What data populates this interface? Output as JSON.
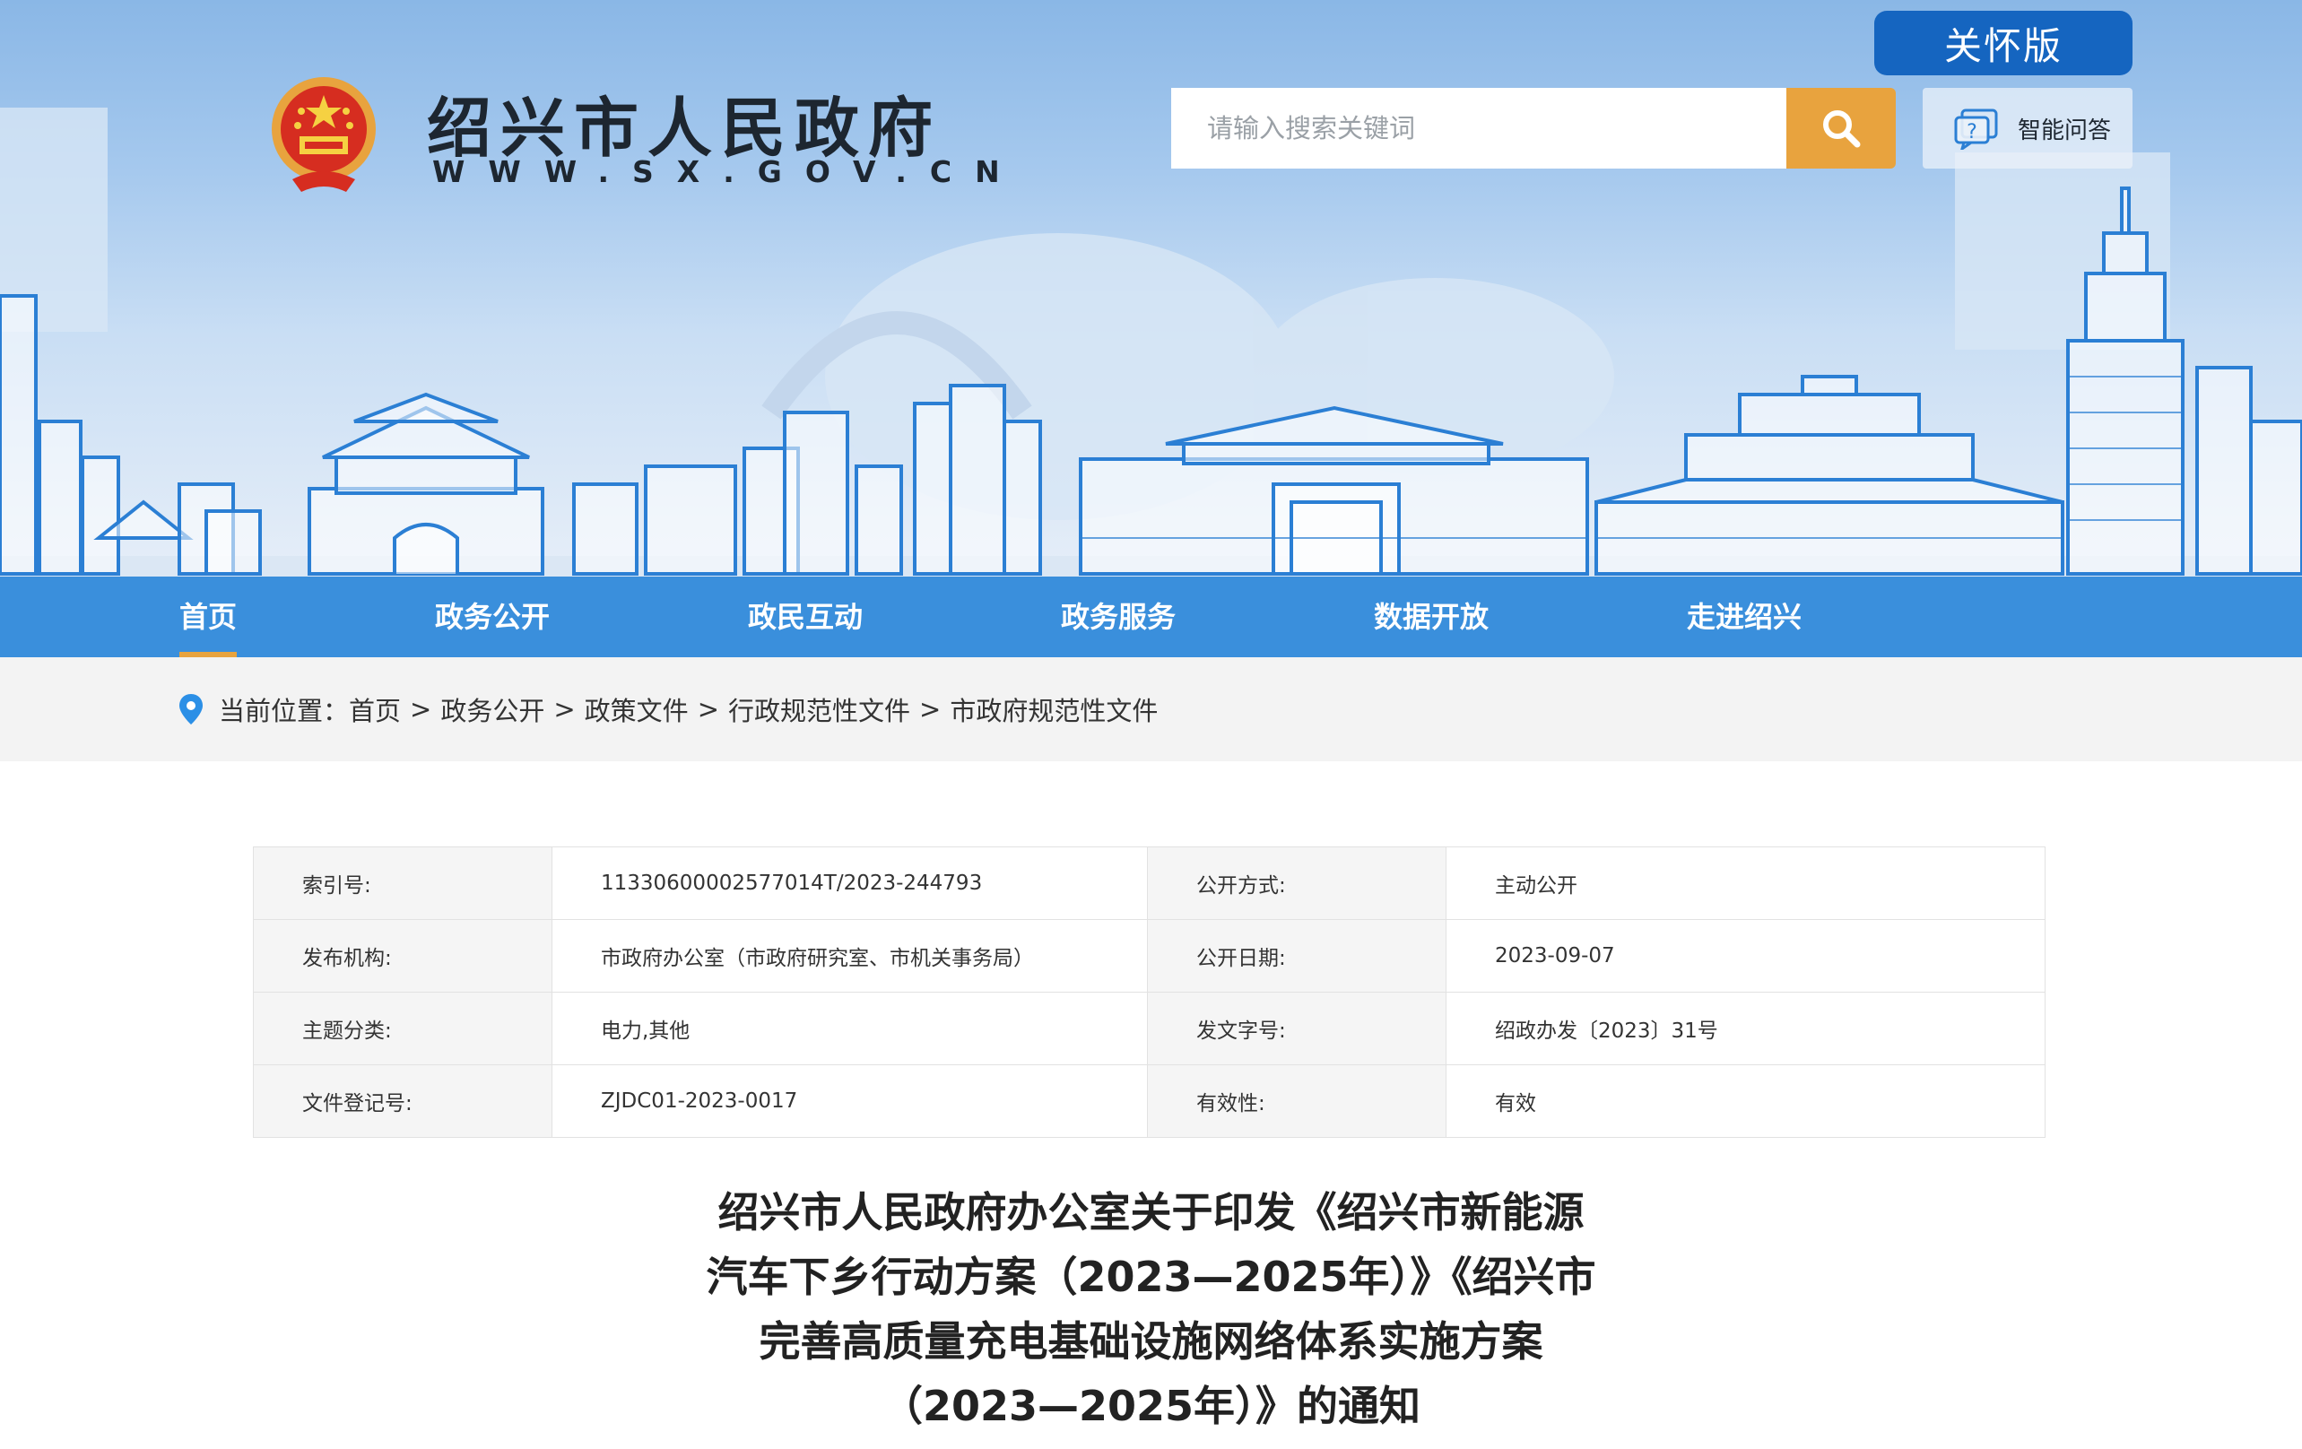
{
  "header": {
    "site_name": "绍兴市人民政府",
    "site_url": "WWW.SX.GOV.CN",
    "care_label": "关怀版",
    "search_placeholder": "请输入搜索关键词",
    "qa_label": "智能问答"
  },
  "nav": {
    "items": [
      {
        "label": "首页",
        "active": true
      },
      {
        "label": "政务公开"
      },
      {
        "label": "政民互动"
      },
      {
        "label": "政务服务"
      },
      {
        "label": "数据开放"
      },
      {
        "label": "走进绍兴"
      }
    ]
  },
  "breadcrumb": {
    "prefix": "当前位置：",
    "items": [
      "首页",
      "政务公开",
      "政策文件",
      "行政规范性文件",
      "市政府规范性文件"
    ],
    "separator": ">"
  },
  "info": {
    "rows": [
      [
        {
          "k": "索引号:",
          "v": "11330600002577014T/2023-244793"
        },
        {
          "k": "公开方式:",
          "v": "主动公开"
        }
      ],
      [
        {
          "k": "发布机构:",
          "v": "市政府办公室（市政府研究室、市机关事务局）"
        },
        {
          "k": "公开日期:",
          "v": "2023-09-07"
        }
      ],
      [
        {
          "k": "主题分类:",
          "v": "电力,其他"
        },
        {
          "k": "发文字号:",
          "v": "绍政办发〔2023〕31号"
        }
      ],
      [
        {
          "k": "文件登记号:",
          "v": "ZJDC01-2023-0017"
        },
        {
          "k": "有效性:",
          "v": "有效"
        }
      ]
    ]
  },
  "document": {
    "title_lines": [
      "绍兴市人民政府办公室关于印发《绍兴市新能源",
      "汽车下乡行动方案（2023—2025年）》《绍兴市",
      "完善高质量充电基础设施网络体系实施方案",
      "（2023—2025年）》的通知"
    ]
  },
  "colors": {
    "nav_bg": "#3a8fdc",
    "accent": "#e8a33e",
    "care_bg": "#1565c0"
  }
}
